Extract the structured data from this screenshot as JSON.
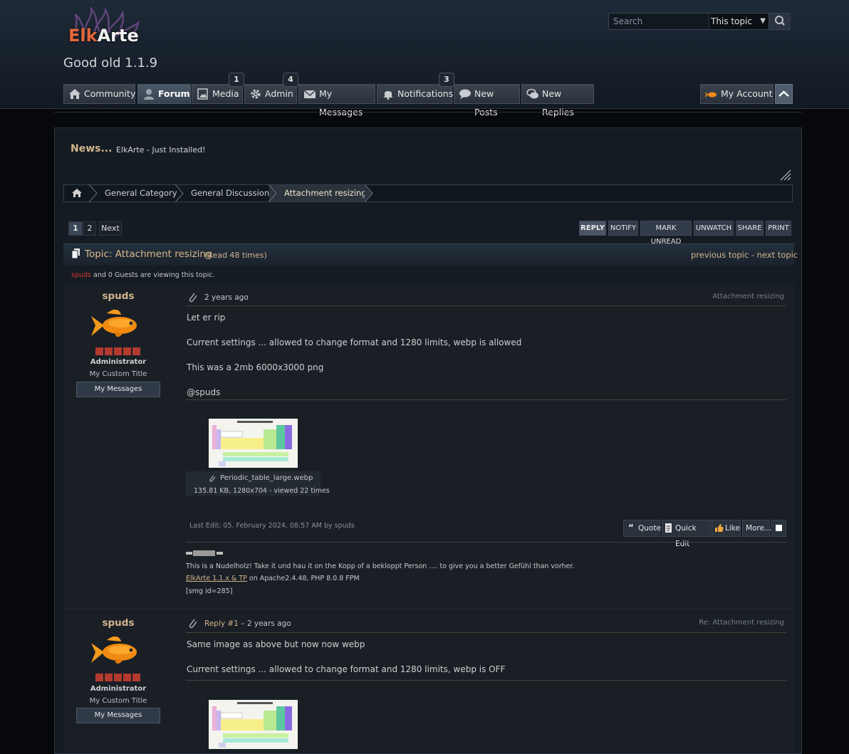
{
  "site": {
    "logo_text": "ElkArte",
    "subtitle": "Good old 1.1.9"
  },
  "search": {
    "placeholder": "Search",
    "scope": "This topic"
  },
  "nav": {
    "community": "Community",
    "forum": "Forum",
    "media": "Media",
    "media_badge": "1",
    "admin": "Admin",
    "admin_badge": "4",
    "messages": "My Messages",
    "notifications": "Notifications",
    "notifications_badge": "3",
    "new_posts": "New Posts",
    "new_replies": "New Replies",
    "my_account": "My Account"
  },
  "news": {
    "label": "News...",
    "text": "ElkArte - Just Installed!"
  },
  "breadcrumb": {
    "items": [
      "General Category",
      "General Discussion",
      "Attachment resizing"
    ]
  },
  "pagination": {
    "pages": [
      "1",
      "2"
    ],
    "next": "Next"
  },
  "topic_buttons": {
    "reply": "REPLY",
    "notify": "NOTIFY",
    "mark_unread": "MARK UNREAD",
    "unwatch": "UNWATCH",
    "share": "SHARE",
    "print": "PRINT"
  },
  "topic": {
    "title": "Topic: Attachment resizing",
    "reads": "(Read 48 times)",
    "prev_next": "previous topic - next topic",
    "viewer_name": "spuds",
    "viewer_rest": "and 0 Guests are viewing this topic."
  },
  "posts": [
    {
      "author": "spuds",
      "role": "Administrator",
      "custom_title": "My Custom Title",
      "pm_label": "My Messages",
      "time": "2 years ago",
      "subject": "Attachment resizing",
      "body": [
        "Let er rip",
        "Current settings ... allowed to change format and 1280 limits, webp is allowed",
        "This was a 2mb 6000x3000 png",
        "@spuds"
      ],
      "attachment": {
        "name": "Periodic_table_large.webp",
        "meta": "135.81 KB, 1280x704 - viewed 22 times"
      },
      "last_edit": "Last Edit: 05. February 2024, 08:57 AM by spuds",
      "actions": {
        "quote": "Quote",
        "quick_edit": "Quick Edit",
        "like": "Like",
        "more": "More..."
      },
      "signature": {
        "line1": "This is a Nudelholz! Take it und hau it on the Kopp of a bekloppt Person .... to give you a better Gefühl than vorher.",
        "link": "ElkArte 1.1.x & TP",
        "link_rest": "on Apache2.4.48, PHP 8.0.8 FPM",
        "line3": "[smg id=285]"
      }
    },
    {
      "author": "spuds",
      "role": "Administrator",
      "custom_title": "My Custom Title",
      "pm_label": "My Messages",
      "reply_label": "Reply #1",
      "time": "2 years ago",
      "subject": "Re: Attachment resizing",
      "body": [
        "Same image as above but now now webp",
        "Current settings ... allowed to change format and 1280 limits, webp is OFF"
      ]
    }
  ],
  "colors": {
    "accent": "#d2b48c",
    "header_bg": "#1e2a38",
    "online_user": "#d9362b"
  }
}
